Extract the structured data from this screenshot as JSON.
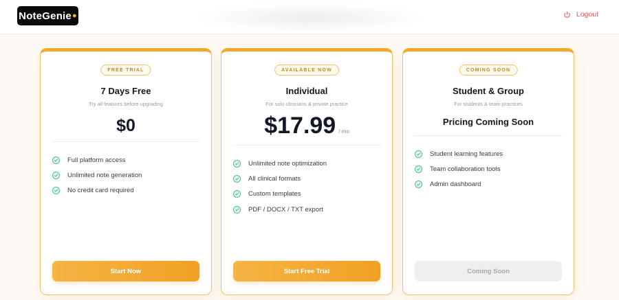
{
  "header": {
    "logo_text": "NoteGenie",
    "logout_label": "Logout",
    "logout_icon": "power-icon"
  },
  "colors": {
    "accent": "#f0a92a",
    "check": "#46c08b",
    "logout": "#e05a5a"
  },
  "plans": [
    {
      "badge": "FREE TRIAL",
      "title": "7 Days Free",
      "subtitle": "Try all features before upgrading",
      "price": "$0",
      "features": [
        "Full platform access",
        "Unlimited note generation",
        "No credit card required"
      ],
      "cta": "Start Now"
    },
    {
      "badge": "AVAILABLE NOW",
      "title": "Individual",
      "subtitle": "For solo clinicians & private practice",
      "price": "$17.99",
      "per": "/ mo",
      "features": [
        "Unlimited note optimization",
        "All clinical formats",
        "Custom templates",
        "PDF / DOCX / TXT export"
      ],
      "cta": "Start Free Trial"
    },
    {
      "badge": "COMING SOON",
      "title": "Student & Group",
      "subtitle": "For students & team practices",
      "coming_label": "Pricing Coming Soon",
      "features": [
        "Student learning features",
        "Team collaboration tools",
        "Admin dashboard"
      ],
      "cta": "Coming Soon",
      "cta_disabled": true
    }
  ]
}
